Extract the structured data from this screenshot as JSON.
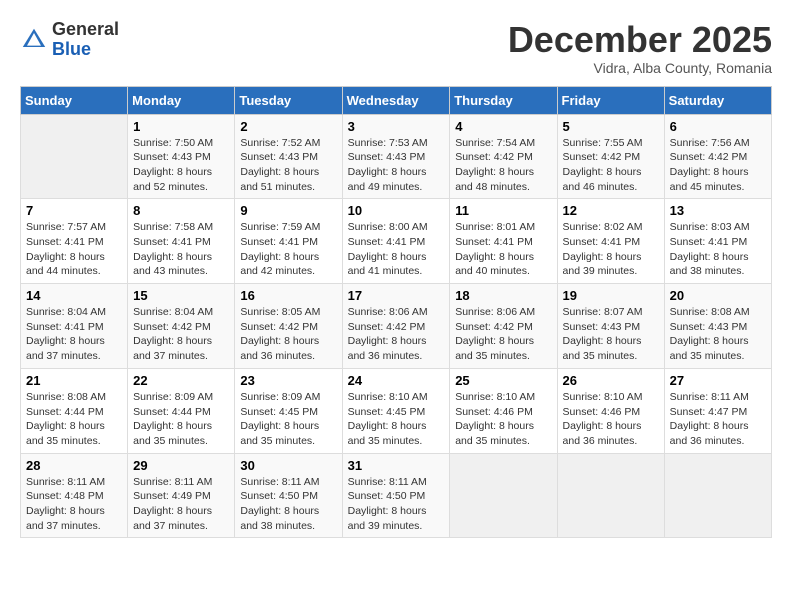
{
  "header": {
    "logo_line1": "General",
    "logo_line2": "Blue",
    "month": "December 2025",
    "location": "Vidra, Alba County, Romania"
  },
  "weekdays": [
    "Sunday",
    "Monday",
    "Tuesday",
    "Wednesday",
    "Thursday",
    "Friday",
    "Saturday"
  ],
  "weeks": [
    [
      {
        "day": "",
        "empty": true
      },
      {
        "day": "1",
        "sunrise": "7:50 AM",
        "sunset": "4:43 PM",
        "daylight": "8 hours and 52 minutes."
      },
      {
        "day": "2",
        "sunrise": "7:52 AM",
        "sunset": "4:43 PM",
        "daylight": "8 hours and 51 minutes."
      },
      {
        "day": "3",
        "sunrise": "7:53 AM",
        "sunset": "4:43 PM",
        "daylight": "8 hours and 49 minutes."
      },
      {
        "day": "4",
        "sunrise": "7:54 AM",
        "sunset": "4:42 PM",
        "daylight": "8 hours and 48 minutes."
      },
      {
        "day": "5",
        "sunrise": "7:55 AM",
        "sunset": "4:42 PM",
        "daylight": "8 hours and 46 minutes."
      },
      {
        "day": "6",
        "sunrise": "7:56 AM",
        "sunset": "4:42 PM",
        "daylight": "8 hours and 45 minutes."
      }
    ],
    [
      {
        "day": "7",
        "sunrise": "7:57 AM",
        "sunset": "4:41 PM",
        "daylight": "8 hours and 44 minutes."
      },
      {
        "day": "8",
        "sunrise": "7:58 AM",
        "sunset": "4:41 PM",
        "daylight": "8 hours and 43 minutes."
      },
      {
        "day": "9",
        "sunrise": "7:59 AM",
        "sunset": "4:41 PM",
        "daylight": "8 hours and 42 minutes."
      },
      {
        "day": "10",
        "sunrise": "8:00 AM",
        "sunset": "4:41 PM",
        "daylight": "8 hours and 41 minutes."
      },
      {
        "day": "11",
        "sunrise": "8:01 AM",
        "sunset": "4:41 PM",
        "daylight": "8 hours and 40 minutes."
      },
      {
        "day": "12",
        "sunrise": "8:02 AM",
        "sunset": "4:41 PM",
        "daylight": "8 hours and 39 minutes."
      },
      {
        "day": "13",
        "sunrise": "8:03 AM",
        "sunset": "4:41 PM",
        "daylight": "8 hours and 38 minutes."
      }
    ],
    [
      {
        "day": "14",
        "sunrise": "8:04 AM",
        "sunset": "4:41 PM",
        "daylight": "8 hours and 37 minutes."
      },
      {
        "day": "15",
        "sunrise": "8:04 AM",
        "sunset": "4:42 PM",
        "daylight": "8 hours and 37 minutes."
      },
      {
        "day": "16",
        "sunrise": "8:05 AM",
        "sunset": "4:42 PM",
        "daylight": "8 hours and 36 minutes."
      },
      {
        "day": "17",
        "sunrise": "8:06 AM",
        "sunset": "4:42 PM",
        "daylight": "8 hours and 36 minutes."
      },
      {
        "day": "18",
        "sunrise": "8:06 AM",
        "sunset": "4:42 PM",
        "daylight": "8 hours and 35 minutes."
      },
      {
        "day": "19",
        "sunrise": "8:07 AM",
        "sunset": "4:43 PM",
        "daylight": "8 hours and 35 minutes."
      },
      {
        "day": "20",
        "sunrise": "8:08 AM",
        "sunset": "4:43 PM",
        "daylight": "8 hours and 35 minutes."
      }
    ],
    [
      {
        "day": "21",
        "sunrise": "8:08 AM",
        "sunset": "4:44 PM",
        "daylight": "8 hours and 35 minutes."
      },
      {
        "day": "22",
        "sunrise": "8:09 AM",
        "sunset": "4:44 PM",
        "daylight": "8 hours and 35 minutes."
      },
      {
        "day": "23",
        "sunrise": "8:09 AM",
        "sunset": "4:45 PM",
        "daylight": "8 hours and 35 minutes."
      },
      {
        "day": "24",
        "sunrise": "8:10 AM",
        "sunset": "4:45 PM",
        "daylight": "8 hours and 35 minutes."
      },
      {
        "day": "25",
        "sunrise": "8:10 AM",
        "sunset": "4:46 PM",
        "daylight": "8 hours and 35 minutes."
      },
      {
        "day": "26",
        "sunrise": "8:10 AM",
        "sunset": "4:46 PM",
        "daylight": "8 hours and 36 minutes."
      },
      {
        "day": "27",
        "sunrise": "8:11 AM",
        "sunset": "4:47 PM",
        "daylight": "8 hours and 36 minutes."
      }
    ],
    [
      {
        "day": "28",
        "sunrise": "8:11 AM",
        "sunset": "4:48 PM",
        "daylight": "8 hours and 37 minutes."
      },
      {
        "day": "29",
        "sunrise": "8:11 AM",
        "sunset": "4:49 PM",
        "daylight": "8 hours and 37 minutes."
      },
      {
        "day": "30",
        "sunrise": "8:11 AM",
        "sunset": "4:50 PM",
        "daylight": "8 hours and 38 minutes."
      },
      {
        "day": "31",
        "sunrise": "8:11 AM",
        "sunset": "4:50 PM",
        "daylight": "8 hours and 39 minutes."
      },
      {
        "day": "",
        "empty": true
      },
      {
        "day": "",
        "empty": true
      },
      {
        "day": "",
        "empty": true
      }
    ]
  ]
}
